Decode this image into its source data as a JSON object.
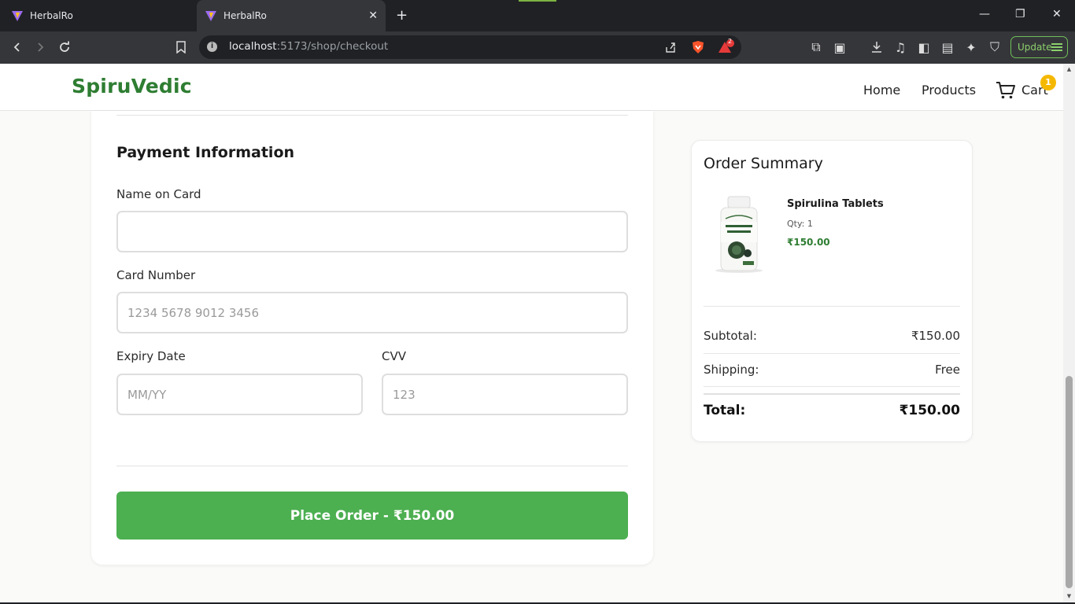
{
  "browser": {
    "tabs": [
      {
        "title": "HerbalRo"
      },
      {
        "title": "HerbalRo"
      }
    ],
    "url_host": "localhost",
    "url_path": ":5173/shop/checkout",
    "extension_badge": "2",
    "update_label": "Update"
  },
  "site": {
    "logo": "SpiruVedic",
    "nav": {
      "home": "Home",
      "products": "Products",
      "cart": "Cart"
    },
    "cart_count": "1"
  },
  "payment": {
    "title": "Payment Information",
    "name_label": "Name on Card",
    "name_value": "",
    "card_label": "Card Number",
    "card_placeholder": "1234 5678 9012 3456",
    "expiry_label": "Expiry Date",
    "expiry_placeholder": "MM/YY",
    "cvv_label": "CVV",
    "cvv_placeholder": "123",
    "place_order": "Place Order - ₹150.00"
  },
  "summary": {
    "title": "Order Summary",
    "item": {
      "name": "Spirulina Tablets",
      "qty": "Qty: 1",
      "price": "₹150.00"
    },
    "subtotal_label": "Subtotal:",
    "subtotal_value": "₹150.00",
    "shipping_label": "Shipping:",
    "shipping_value": "Free",
    "total_label": "Total:",
    "total_value": "₹150.00"
  },
  "colors": {
    "brand": "#2e7d32",
    "button": "#4caf50",
    "badge": "#f5b800"
  }
}
